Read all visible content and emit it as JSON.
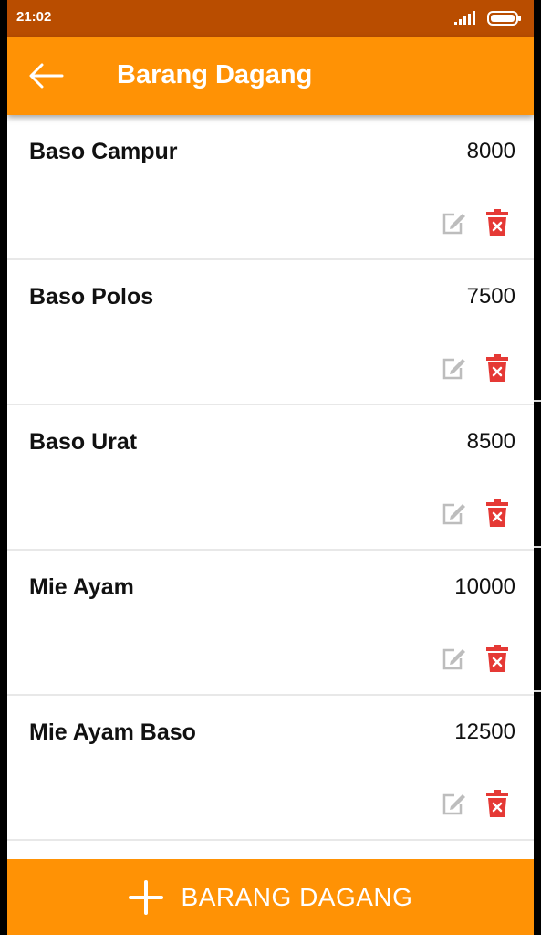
{
  "status_bar": {
    "time": "21:02"
  },
  "app_bar": {
    "title": "Barang Dagang",
    "back_icon": "arrow-left-icon"
  },
  "items": [
    {
      "name": "Baso Campur",
      "price": "8000"
    },
    {
      "name": "Baso Polos",
      "price": "7500"
    },
    {
      "name": "Baso Urat",
      "price": "8500"
    },
    {
      "name": "Mie Ayam",
      "price": "10000"
    },
    {
      "name": "Mie Ayam Baso",
      "price": "12500"
    }
  ],
  "icons": {
    "edit": "edit-icon",
    "delete": "trash-icon"
  },
  "add_button": {
    "label": "BARANG DAGANG",
    "icon": "plus-icon"
  },
  "colors": {
    "primary": "#ff9205",
    "status_bar": "#b94d00",
    "delete": "#e53935",
    "edit": "#bdbdbd"
  }
}
